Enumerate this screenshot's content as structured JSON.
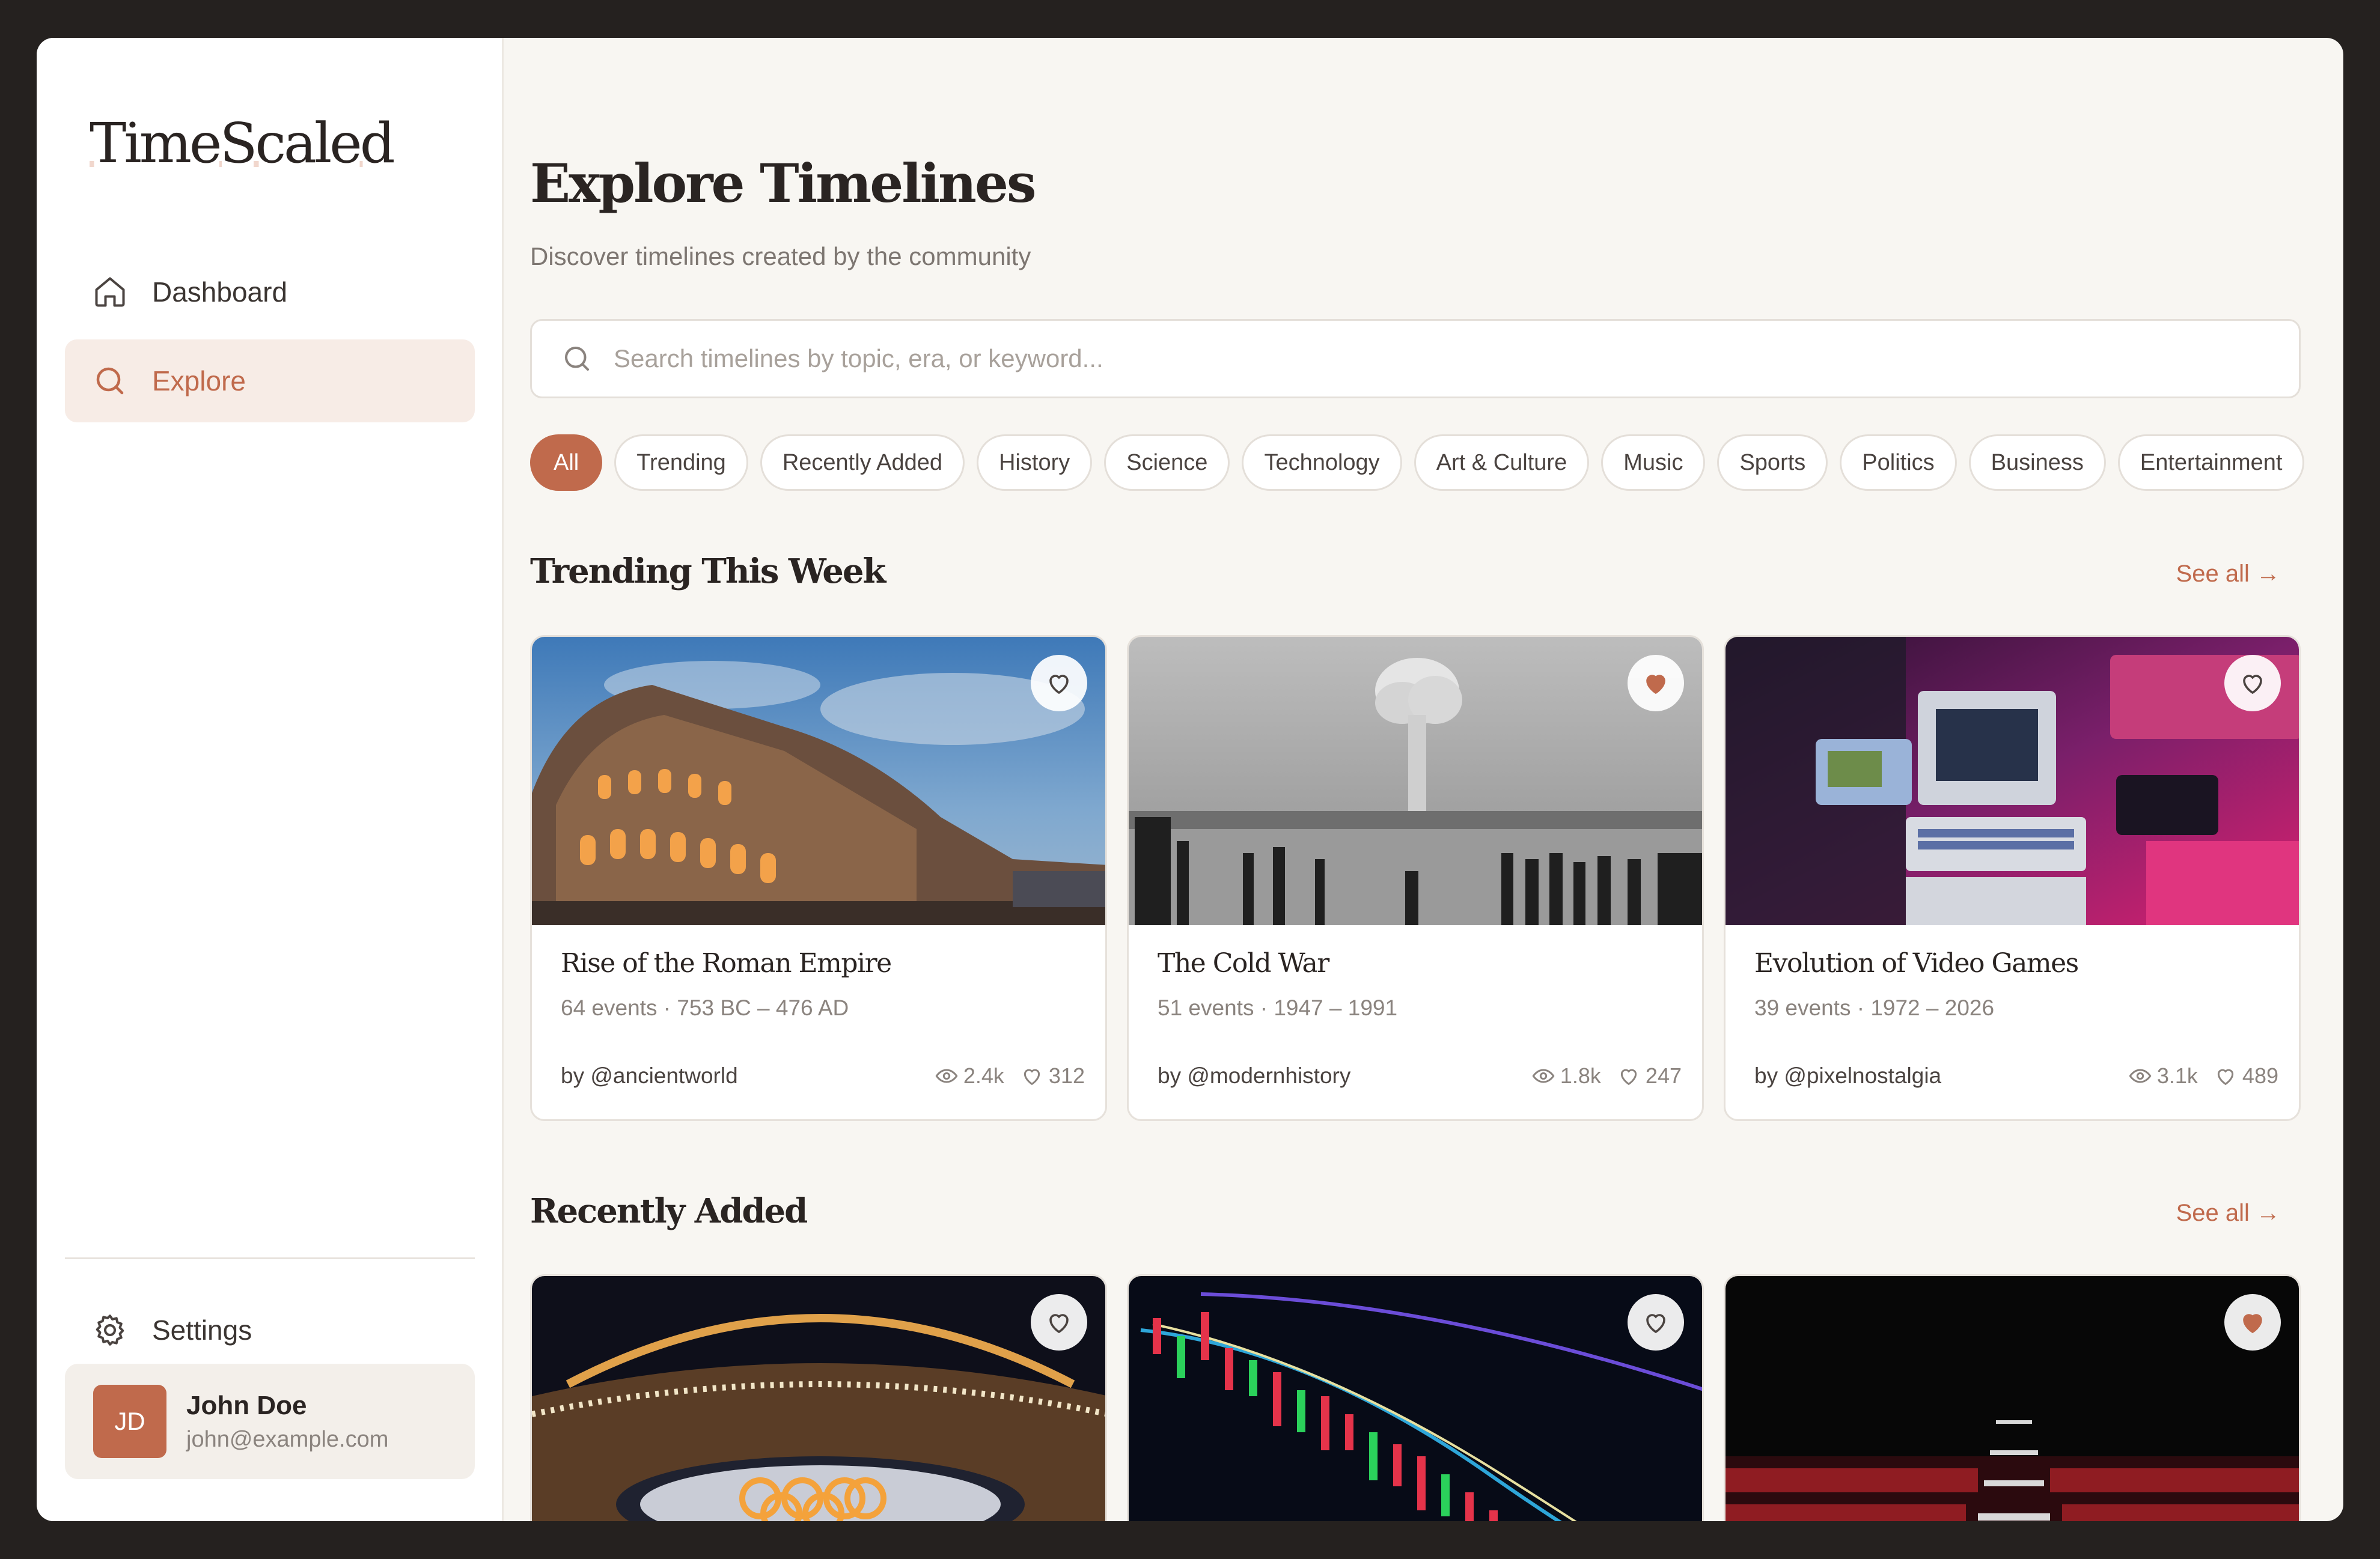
{
  "app": {
    "logo": "TimeScaled"
  },
  "sidebar": {
    "items": [
      {
        "label": "Dashboard",
        "icon": "home-icon"
      },
      {
        "label": "Explore",
        "icon": "search-icon",
        "active": true
      }
    ],
    "settings_label": "Settings",
    "user": {
      "initials": "JD",
      "name": "John Doe",
      "email": "john@example.com"
    }
  },
  "main": {
    "title": "Explore Timelines",
    "subtitle": "Discover timelines created by the community",
    "search": {
      "placeholder": "Search timelines by topic, era, or keyword..."
    },
    "filters": [
      "All",
      "Trending",
      "Recently Added",
      "History",
      "Science",
      "Technology",
      "Art & Culture",
      "Music",
      "Sports",
      "Politics",
      "Business",
      "Entertainment"
    ],
    "active_filter": "All",
    "trending": {
      "title": "Trending This Week",
      "see_all": "See all →",
      "cards": [
        {
          "title": "Rise of the Roman Empire",
          "meta": "64 events · 753 BC – 476 AD",
          "author": "by @ancientworld",
          "views": "2.4k",
          "likes": "312",
          "favorited": false,
          "image": "colosseum-photo"
        },
        {
          "title": "The Cold War",
          "meta": "51 events · 1947 – 1991",
          "author": "by @modernhistory",
          "views": "1.8k",
          "likes": "247",
          "favorited": true,
          "image": "mushroom-cloud-photo"
        },
        {
          "title": "Evolution of Video Games",
          "meta": "39 events · 1972 – 2026",
          "author": "by @pixelnostalgia",
          "views": "3.1k",
          "likes": "489",
          "favorited": false,
          "image": "retro-computers-photo"
        }
      ]
    },
    "recent": {
      "title": "Recently Added",
      "see_all": "See all →",
      "cards": [
        {
          "image": "olympic-stadium-photo",
          "favorited": false
        },
        {
          "image": "stock-chart-photo",
          "favorited": false
        },
        {
          "image": "theater-seats-photo",
          "favorited": true
        }
      ]
    }
  },
  "colors": {
    "accent": "#c06a4c",
    "background": "#f8f6f2",
    "frame": "#25211f"
  }
}
